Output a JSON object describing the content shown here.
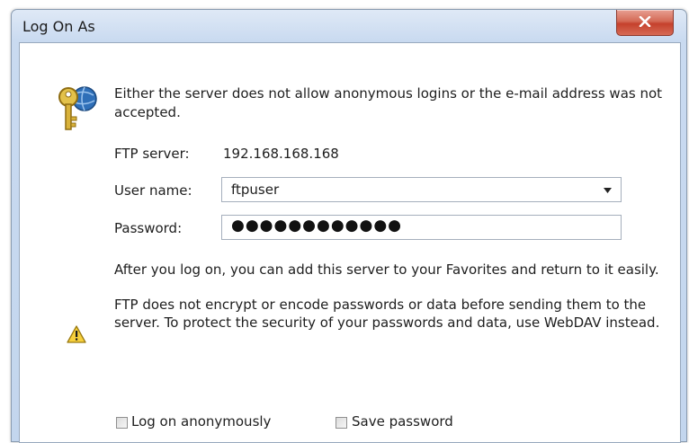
{
  "window": {
    "title": "Log On As",
    "close_glyph": "x"
  },
  "message": "Either the server does not allow anonymous logins or the e-mail address was not accepted.",
  "ftp_server": {
    "label": "FTP server:",
    "value": "192.168.168.168"
  },
  "user_name": {
    "label": "User name:",
    "value": "ftpuser"
  },
  "password": {
    "label": "Password:",
    "masked_value": "●●●●●●●●●●●●"
  },
  "info_text": "After you log on, you can add this server to your Favorites and return to it easily.",
  "warning": {
    "line1": "FTP does not encrypt or encode passwords or data before sending them to the",
    "line2": "server.  To protect the security of your passwords and data, use WebDAV instead."
  },
  "checkboxes": {
    "anonymous": {
      "label": "Log on anonymously",
      "checked": false
    },
    "save_password": {
      "label": "Save password",
      "checked": false
    }
  },
  "icons": {
    "key": "key-icon",
    "warning": "warning-icon",
    "dropdown": "chevron-down-icon",
    "close": "close-icon"
  }
}
